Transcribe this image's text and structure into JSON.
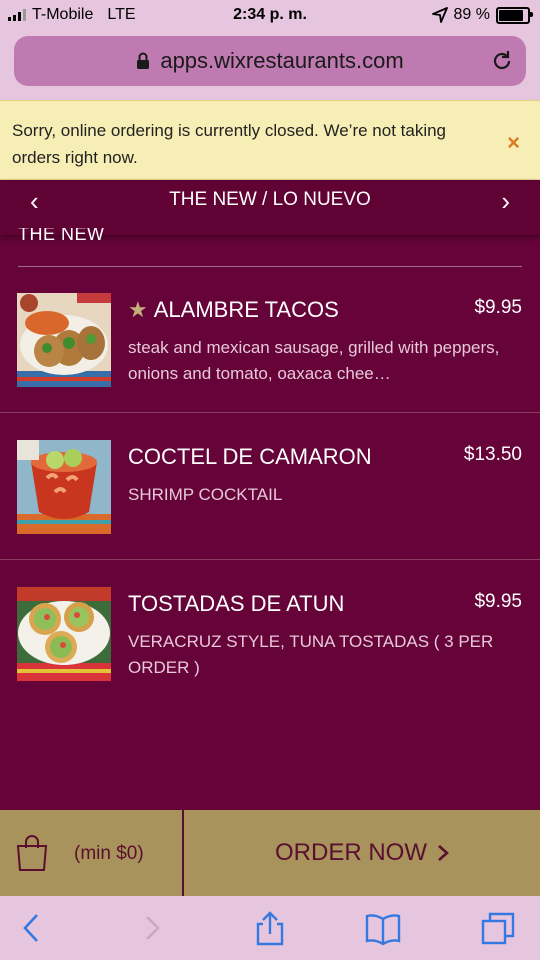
{
  "status_bar": {
    "carrier": "T-Mobile",
    "network": "LTE",
    "time": "2:34 p. m.",
    "battery": "89 %"
  },
  "browser": {
    "url": "apps.wixrestaurants.com"
  },
  "banner": {
    "message": "Sorry, online ordering is currently closed. We’re not taking orders right now.",
    "close_icon": "×"
  },
  "category_nav": {
    "title": "THE NEW / LO NUEVO",
    "prev_icon": "‹",
    "next_icon": "›"
  },
  "section_header": "THE NEW",
  "menu_items": [
    {
      "name": "ALAMBRE TACOS",
      "featured": true,
      "price": "$9.95",
      "description": "steak and mexican sausage, grilled with peppers, onions and tomato, oaxaca chee…"
    },
    {
      "name": "COCTEL DE CAMARON",
      "featured": false,
      "price": "$13.50",
      "description": "SHRIMP COCKTAIL"
    },
    {
      "name": "TOSTADAS DE ATUN",
      "featured": false,
      "price": "$9.95",
      "description": "VERACRUZ STYLE, TUNA TOSTADAS ( 3 PER ORDER )"
    }
  ],
  "order_bar": {
    "min_text": "(min $0)",
    "order_label": "ORDER NOW"
  },
  "colors": {
    "background": "#660339",
    "accent_gold": "#a8935c",
    "banner": "#f6eeb5",
    "text_dark": "#5a0f2e"
  }
}
